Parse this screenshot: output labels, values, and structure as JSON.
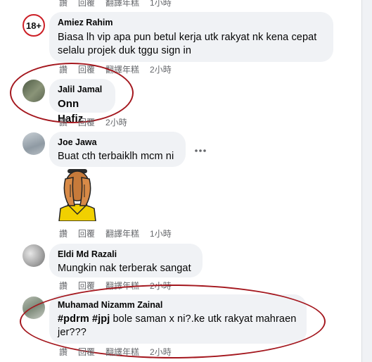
{
  "actions": {
    "like": "讚",
    "reply": "回覆",
    "translate": "翻譯年糕"
  },
  "comments": [
    {
      "author": "",
      "text": "",
      "time": "1小時"
    },
    {
      "author": "Amiez Rahim",
      "text": "Biasa lh vip apa pun betul kerja utk rakyat nk kena cepat selalu projek duk tggu sign in",
      "time": "2小時",
      "avatar_badge": "18+"
    },
    {
      "author": "Jalil Jamal",
      "text": "Onn Hafiz",
      "time": "2小時"
    },
    {
      "author": "Joe Jawa",
      "text": "Buat cth terbaiklh mcm ni",
      "time": "1小時"
    },
    {
      "author": "Eldi Md Razali",
      "text": "Mungkin nak terberak sangat",
      "time": "2小時"
    },
    {
      "author": "Muhamad Nizamm Zainal",
      "hashtags": [
        "#pdrm",
        "#jpj"
      ],
      "text": " bole saman x ni?.ke utk rakyat mahraen jer???",
      "time": "2小時"
    }
  ],
  "icons": {
    "more": "more-horizontal-icon",
    "sticker": "covering-face-sticker"
  },
  "colors": {
    "bubble": "#f0f2f5",
    "secondary_text": "#65676b",
    "annotation_circle": "#a4171e"
  }
}
